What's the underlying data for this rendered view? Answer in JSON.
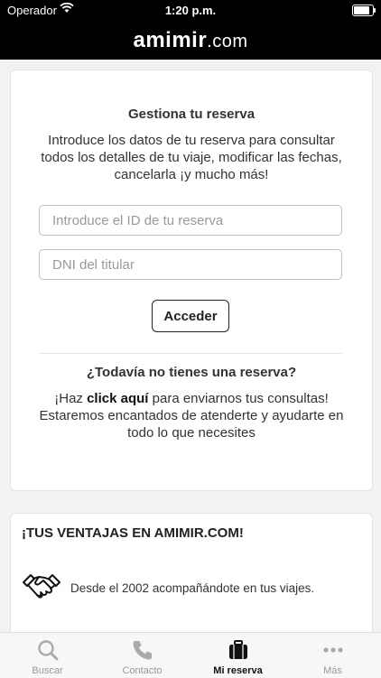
{
  "status_bar": {
    "carrier": "Operador",
    "time": "1:20 p.m.",
    "battery_level": 0.95,
    "icons": [
      "wifi-icon",
      "battery-icon"
    ]
  },
  "header": {
    "logo_text": "amimir",
    "logo_suffix": ".com"
  },
  "reserve_card": {
    "title": "Gestiona tu reserva",
    "description": "Introduce los datos de tu reserva para consultar todos los detalles de tu viaje, modificar las fechas, cancelarla ¡y mucho más!",
    "id_input": {
      "value": "",
      "placeholder": "Introduce el ID de tu reserva"
    },
    "dni_input": {
      "value": "",
      "placeholder": "DNI del titular"
    },
    "access_button": "Acceder",
    "no_reservation_title": "¿Todavía no tienes una reserva?",
    "help_prefix": "¡Haz ",
    "help_link": "click aquí",
    "help_suffix": " para enviarnos tus consultas! Estaremos encantados de atenderte y ayudarte en todo lo que necesites"
  },
  "advantages_card": {
    "title": "¡TUS VENTAJAS EN AMIMIR.COM!",
    "items": [
      {
        "icon": "handshake-icon",
        "text": "Desde el 2002 acompañándote en tus viajes."
      }
    ]
  },
  "tab_bar": {
    "tabs": [
      {
        "label": "Buscar",
        "icon": "search-icon",
        "active": false
      },
      {
        "label": "Contacto",
        "icon": "phone-icon",
        "active": false
      },
      {
        "label": "Mi reserva",
        "icon": "briefcase-icon",
        "active": true
      },
      {
        "label": "Más",
        "icon": "more-icon",
        "active": false
      }
    ]
  },
  "colors": {
    "header_background": "#000000",
    "page_background": "#f2f2f2",
    "tab_inactive": "#999999",
    "tab_active": "#111111"
  }
}
